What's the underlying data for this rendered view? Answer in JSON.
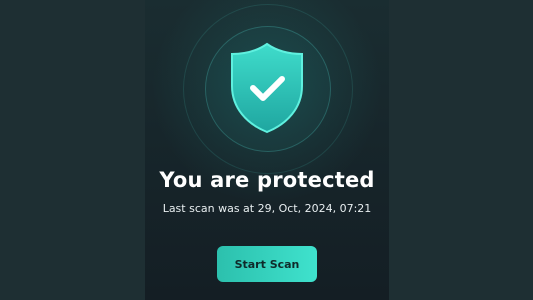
{
  "status": {
    "title": "You are protected",
    "last_scan": "Last scan was at 29, Oct, 2024, 07:21"
  },
  "actions": {
    "start_scan_label": "Start Scan"
  },
  "icons": {
    "shield": "shield-check-icon"
  },
  "colors": {
    "accent": "#2cc0ad",
    "accent_light": "#3fe2cd",
    "background": "#1e2f33",
    "panel": "#17262b"
  }
}
